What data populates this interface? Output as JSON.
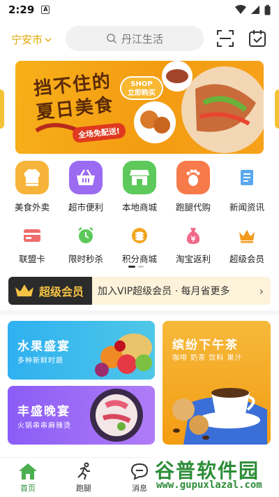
{
  "status": {
    "time": "2:29",
    "notif": "A"
  },
  "header": {
    "city": "宁安市",
    "search_placeholder": "丹江生活"
  },
  "banner": {
    "title_line1": "挡不住的",
    "title_line2": "夏日美食",
    "pill": "全场免配送!",
    "shop_line1": "SHOP",
    "shop_line2": "立即购买"
  },
  "primary_grid": [
    {
      "label": "美食外卖",
      "icon": "chef-hat-icon",
      "color": "#f7b43a"
    },
    {
      "label": "超市便利",
      "icon": "shopping-basket-icon",
      "color": "#9b6bf2"
    },
    {
      "label": "本地商城",
      "icon": "storefront-icon",
      "color": "#5cc95a"
    },
    {
      "label": "跑腿代购",
      "icon": "footprint-icon",
      "color": "#f77a4a"
    },
    {
      "label": "新闻资讯",
      "icon": "news-icon",
      "color": "#5aa9f0"
    }
  ],
  "secondary_grid": [
    {
      "label": "联盟卡",
      "icon": "card-icon",
      "color": "#f06b6b"
    },
    {
      "label": "限时秒杀",
      "icon": "alarm-clock-icon",
      "color": "#5cc95a"
    },
    {
      "label": "积分商城",
      "icon": "coins-icon",
      "color": "#f2a51e"
    },
    {
      "label": "淘宝返利",
      "icon": "money-bag-icon",
      "color": "#f06b8a"
    },
    {
      "label": "超级会员",
      "icon": "crown-icon",
      "color": "#f29a1e"
    }
  ],
  "vip": {
    "badge": "超级会员",
    "text": "加入VIP超级会员 · 每月省更多",
    "arrow": "›"
  },
  "cards": {
    "fruit": {
      "title": "水果盛宴",
      "sub": "多种新鲜时蔬"
    },
    "tea": {
      "title": "缤纷下午茶",
      "sub": "咖啡 奶茶 饮料 果汁"
    },
    "dinner": {
      "title": "丰盛晚宴",
      "sub": "火锅串串麻辣烫"
    }
  },
  "tabs": [
    {
      "label": "首页",
      "icon": "home-icon"
    },
    {
      "label": "跑腿",
      "icon": "runner-icon"
    },
    {
      "label": "消息",
      "icon": "chat-icon"
    }
  ],
  "watermark": {
    "line1": "谷普软件园",
    "line2": "www.gupuxlazal.com"
  }
}
